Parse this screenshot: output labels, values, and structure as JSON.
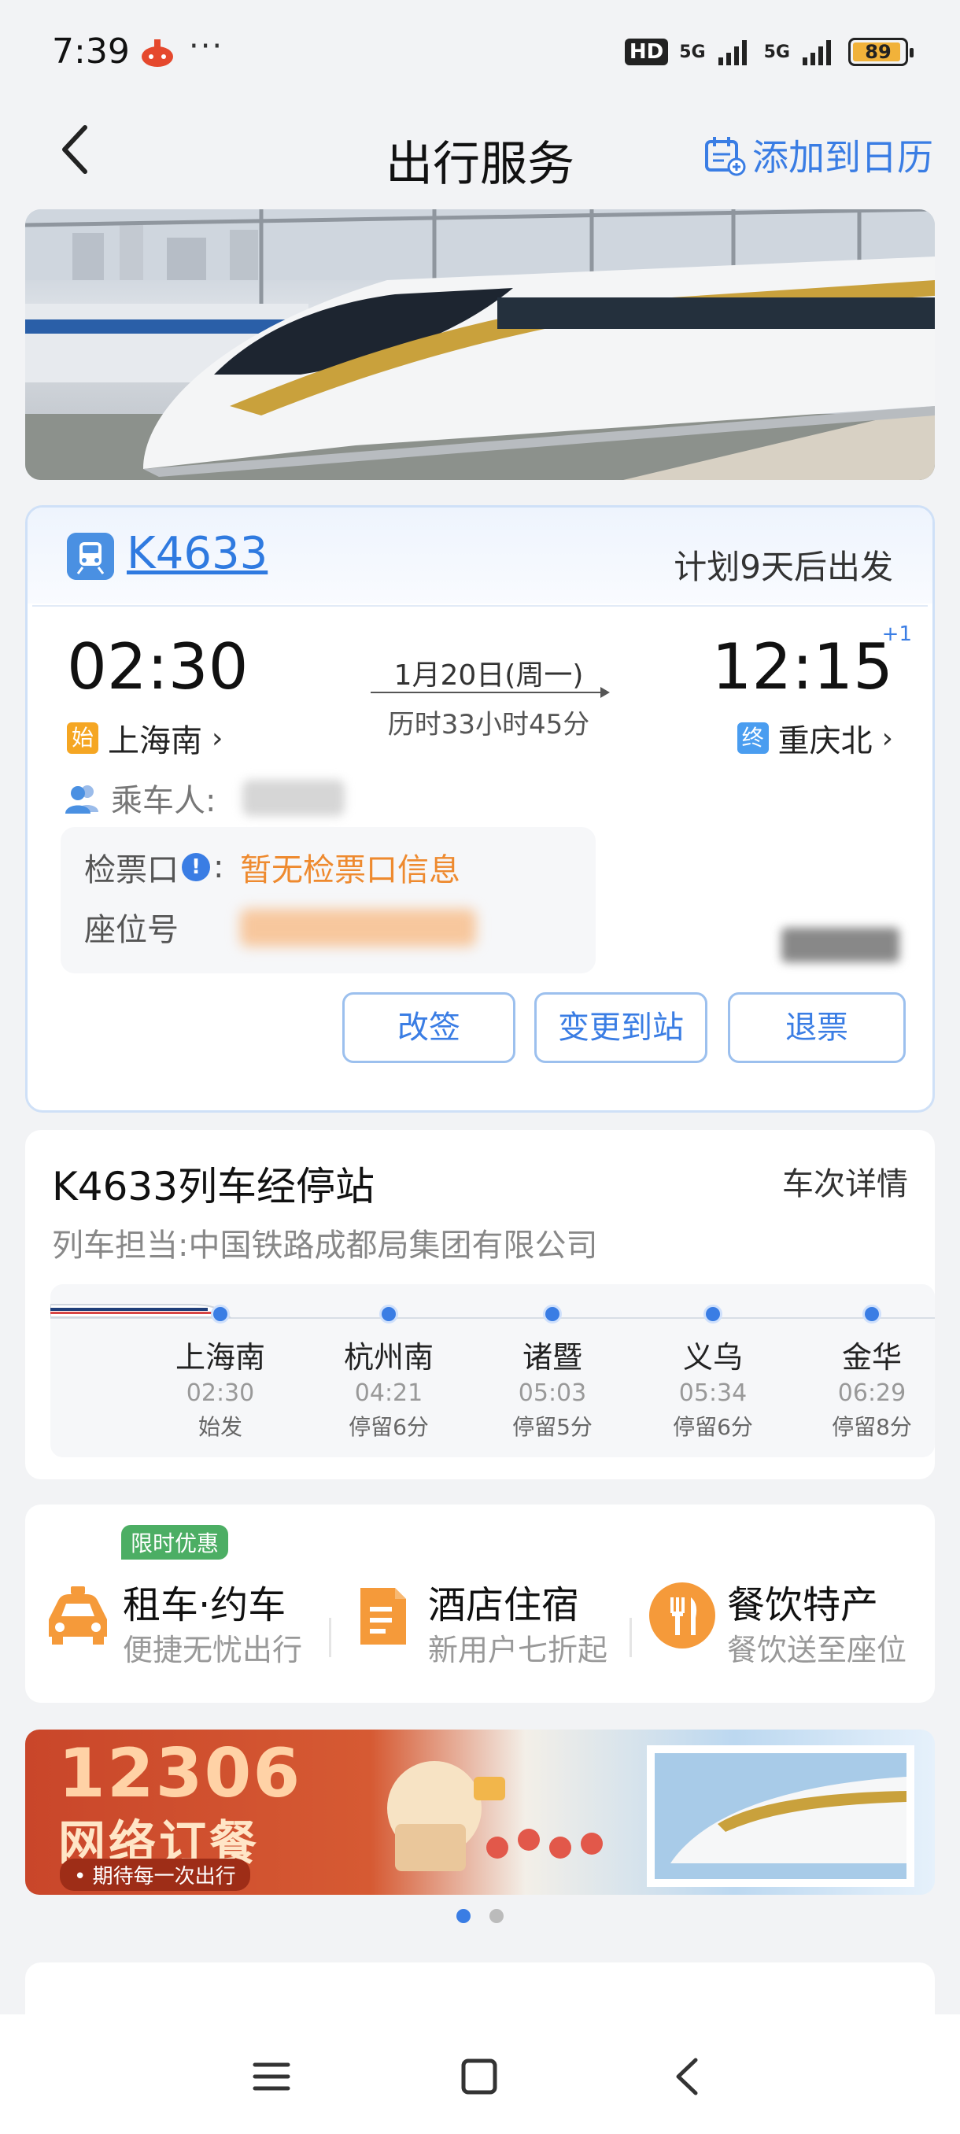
{
  "status_bar": {
    "time": "7:39",
    "more": "···",
    "hd": "HD",
    "net1": "5G",
    "net2": "5G",
    "battery": "89"
  },
  "header": {
    "title": "出行服务",
    "calendar_label": "添加到日历"
  },
  "ticket": {
    "train_code": "K4633",
    "depart_plan": "计划9天后出发",
    "depart_time": "02:30",
    "arrive_time": "12:15",
    "day_offset": "+1",
    "date": "1月20日(周一)",
    "duration": "历时33小时45分",
    "depart_tag": "始",
    "depart_station": "上海南",
    "arrive_tag": "终",
    "arrive_station": "重庆北",
    "chevron": "›",
    "passenger_label": "乘车人:",
    "check_label": "检票口",
    "check_colon": ":",
    "check_value": "暂无检票口信息",
    "seat_label": "座位号",
    "btn_change": "改签",
    "btn_station": "变更到站",
    "btn_refund": "退票"
  },
  "stops": {
    "title": "K4633列车经停站",
    "detail_link": "车次详情",
    "operator": "列车担当:中国铁路成都局集团有限公司",
    "items": [
      {
        "name": "上海南",
        "time": "02:30",
        "note": "始发"
      },
      {
        "name": "杭州南",
        "time": "04:21",
        "note": "停留6分"
      },
      {
        "name": "诸暨",
        "time": "05:03",
        "note": "停留5分"
      },
      {
        "name": "义乌",
        "time": "05:34",
        "note": "停留6分"
      },
      {
        "name": "金华",
        "time": "06:29",
        "note": "停留8分"
      }
    ]
  },
  "services": {
    "promo_badge": "限时优惠",
    "items": [
      {
        "title": "租车·约车",
        "sub": "便捷无忧出行",
        "icon": "car-icon"
      },
      {
        "title": "酒店住宿",
        "sub": "新用户七折起",
        "icon": "hotel-icon"
      },
      {
        "title": "餐饮特产",
        "sub": "餐饮送至座位",
        "icon": "dining-icon"
      }
    ]
  },
  "ad": {
    "number": "12306",
    "title": "网络订餐",
    "slogan": "• 期待每一次出行"
  },
  "colors": {
    "accent": "#3a7de4",
    "orange": "#ee8a2f",
    "green": "#4cae64"
  }
}
